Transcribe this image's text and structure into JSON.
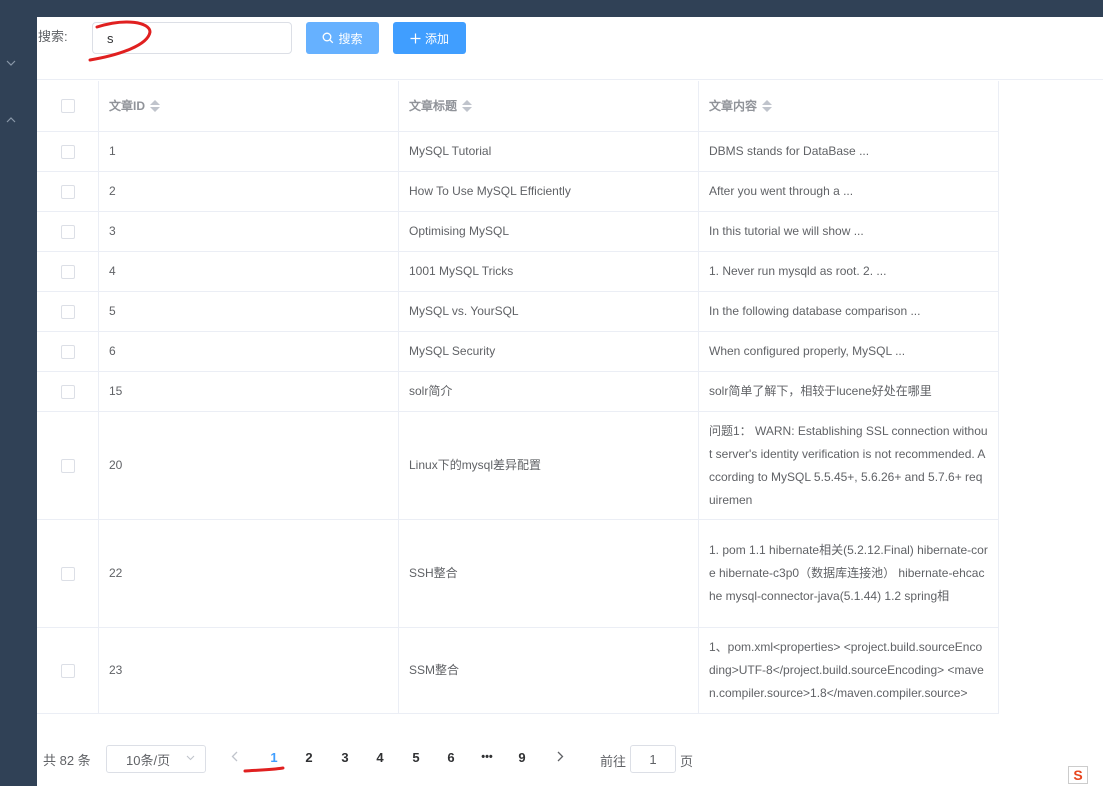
{
  "search": {
    "label": "搜索:",
    "value": "s",
    "button_label": "搜索",
    "add_label": "添加"
  },
  "table": {
    "headers": [
      "文章ID",
      "文章标题",
      "文章内容"
    ],
    "rows": [
      {
        "id": "1",
        "title": "MySQL Tutorial",
        "content": "DBMS stands for DataBase ..."
      },
      {
        "id": "2",
        "title": "How To Use MySQL Efficiently",
        "content": "After you went through a ..."
      },
      {
        "id": "3",
        "title": "Optimising MySQL",
        "content": "In this tutorial we will show ..."
      },
      {
        "id": "4",
        "title": "1001 MySQL Tricks",
        "content": "1. Never run mysqld as root. 2. ..."
      },
      {
        "id": "5",
        "title": "MySQL vs. YourSQL",
        "content": "In the following database comparison ..."
      },
      {
        "id": "6",
        "title": "MySQL Security",
        "content": "When configured properly, MySQL ..."
      },
      {
        "id": "15",
        "title": "solr简介",
        "content": "solr简单了解下，相较于lucene好处在哪里"
      },
      {
        "id": "20",
        "title": "Linux下的mysql差异配置",
        "content": "问题1： WARN: Establishing SSL connection without server's identity verification is not recommended. According to MySQL 5.5.45+, 5.6.26+ and 5.7.6+ requiremen"
      },
      {
        "id": "22",
        "title": "SSH整合",
        "content": "1. pom  1.1 hibernate相关(5.2.12.Final)     hibernate-core     hibernate-c3p0（数据库连接池）     hibernate-ehcache     mysql-connector-java(5.1.44)  1.2 spring相"
      },
      {
        "id": "23",
        "title": "SSM整合",
        "content": "1、pom.xml<properties> <project.build.sourceEncoding>UTF-8</project.build.sourceEncoding> <maven.compiler.source>1.8</maven.compiler.source>"
      }
    ]
  },
  "pagination": {
    "total": "共 82 条",
    "page_size": "10条/页",
    "pages": [
      "1",
      "2",
      "3",
      "4",
      "5",
      "6",
      "•••",
      "9"
    ],
    "current": "1",
    "jump_label": "前往",
    "jump_value": "1",
    "jump_suffix": "页"
  },
  "ime": {
    "glyph": "S"
  },
  "colors": {
    "sidebar": "#304156",
    "primary": "#409eff",
    "search_button": "#66b1ff",
    "annotation": "#e02020"
  }
}
